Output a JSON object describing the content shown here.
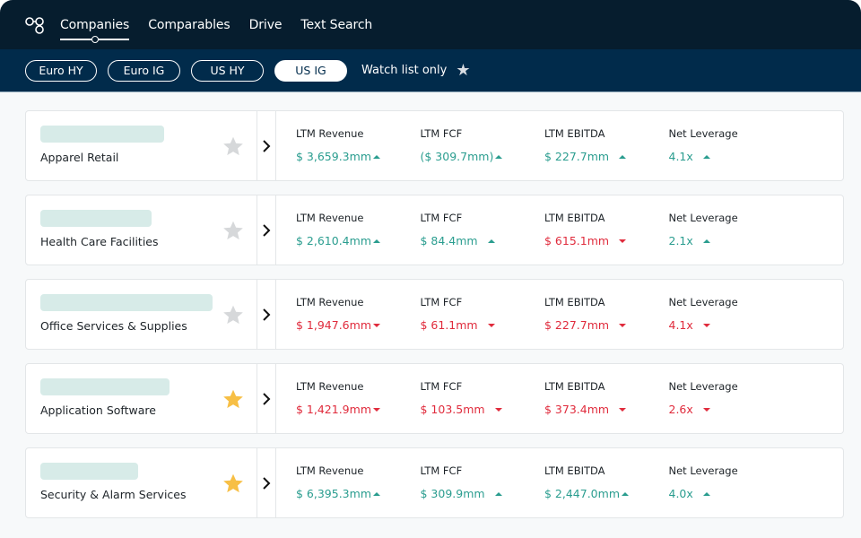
{
  "nav": {
    "logo_icon": "nodes-logo-icon",
    "items": [
      {
        "label": "Companies",
        "active": true
      },
      {
        "label": "Comparables",
        "active": false
      },
      {
        "label": "Drive",
        "active": false
      },
      {
        "label": "Text Search",
        "active": false
      }
    ]
  },
  "filters": {
    "pills": [
      {
        "label": "Euro HY",
        "active": false
      },
      {
        "label": "Euro IG",
        "active": false
      },
      {
        "label": "US HY",
        "active": false
      },
      {
        "label": "US IG",
        "active": true
      }
    ],
    "watch_label": "Watch list only",
    "watch_icon": "star-icon"
  },
  "colors": {
    "up": "#2a9d8f",
    "down": "#e02b3c",
    "star_on": "#f7bf45",
    "star_off": "#d6d8da",
    "topbar": "#061d2e",
    "filterbar": "#012b4b"
  },
  "metric_labels": [
    "LTM Revenue",
    "LTM FCF",
    "LTM EBITDA",
    "Net Leverage"
  ],
  "rows": [
    {
      "sector": "Apparel Retail",
      "starred": false,
      "metrics": [
        {
          "label": "LTM Revenue",
          "value": "$ 3,659.3mm",
          "trend": "up"
        },
        {
          "label": "LTM FCF",
          "value": "($ 309.7mm)",
          "trend": "up"
        },
        {
          "label": "LTM EBITDA",
          "value": "$ 227.7mm",
          "trend": "up"
        },
        {
          "label": "Net Leverage",
          "value": "4.1x",
          "trend": "up"
        }
      ]
    },
    {
      "sector": "Health Care Facilities",
      "starred": false,
      "metrics": [
        {
          "label": "LTM Revenue",
          "value": "$ 2,610.4mm",
          "trend": "up"
        },
        {
          "label": "LTM FCF",
          "value": "$ 84.4mm",
          "trend": "up"
        },
        {
          "label": "LTM EBITDA",
          "value": "$ 615.1mm",
          "trend": "down"
        },
        {
          "label": "Net Leverage",
          "value": "2.1x",
          "trend": "up"
        }
      ]
    },
    {
      "sector": "Office Services & Supplies",
      "starred": false,
      "metrics": [
        {
          "label": "LTM Revenue",
          "value": "$ 1,947.6mm",
          "trend": "down"
        },
        {
          "label": "LTM FCF",
          "value": "$ 61.1mm",
          "trend": "down"
        },
        {
          "label": "LTM EBITDA",
          "value": "$ 227.7mm",
          "trend": "down"
        },
        {
          "label": "Net Leverage",
          "value": "4.1x",
          "trend": "down"
        }
      ]
    },
    {
      "sector": "Application Software",
      "starred": true,
      "metrics": [
        {
          "label": "LTM Revenue",
          "value": "$ 1,421.9mm",
          "trend": "down"
        },
        {
          "label": "LTM FCF",
          "value": "$ 103.5mm",
          "trend": "down"
        },
        {
          "label": "LTM EBITDA",
          "value": "$ 373.4mm",
          "trend": "down"
        },
        {
          "label": "Net Leverage",
          "value": "2.6x",
          "trend": "down"
        }
      ]
    },
    {
      "sector": "Security & Alarm Services",
      "starred": true,
      "metrics": [
        {
          "label": "LTM Revenue",
          "value": "$ 6,395.3mm",
          "trend": "up"
        },
        {
          "label": "LTM FCF",
          "value": "$ 309.9mm",
          "trend": "up"
        },
        {
          "label": "LTM EBITDA",
          "value": "$ 2,447.0mm",
          "trend": "up"
        },
        {
          "label": "Net Leverage",
          "value": "4.0x",
          "trend": "up"
        }
      ]
    }
  ]
}
